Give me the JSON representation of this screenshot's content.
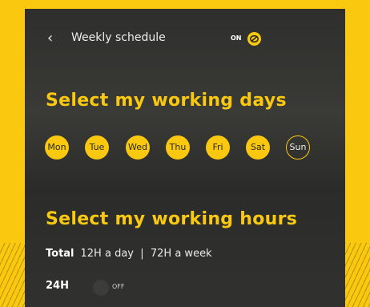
{
  "header": {
    "back_icon": "chevron-left-icon",
    "title": "Weekly schedule",
    "toggle_label": "ON",
    "toggle_icon": "link-icon"
  },
  "days_section": {
    "heading": "Select my working days",
    "days": [
      {
        "label": "Mon",
        "selected": true
      },
      {
        "label": "Tue",
        "selected": true
      },
      {
        "label": "Wed",
        "selected": true
      },
      {
        "label": "Thu",
        "selected": true
      },
      {
        "label": "Fri",
        "selected": true
      },
      {
        "label": "Sat",
        "selected": true
      },
      {
        "label": "Sun",
        "selected": false
      }
    ]
  },
  "hours_section": {
    "heading": "Select my working hours",
    "total_label": "Total",
    "total_value": "12H a day  |  72H a week",
    "h24_label": "24H",
    "h24_toggle": "OFF"
  },
  "colors": {
    "accent": "#f9c80f",
    "background": "#2e2e2c"
  }
}
